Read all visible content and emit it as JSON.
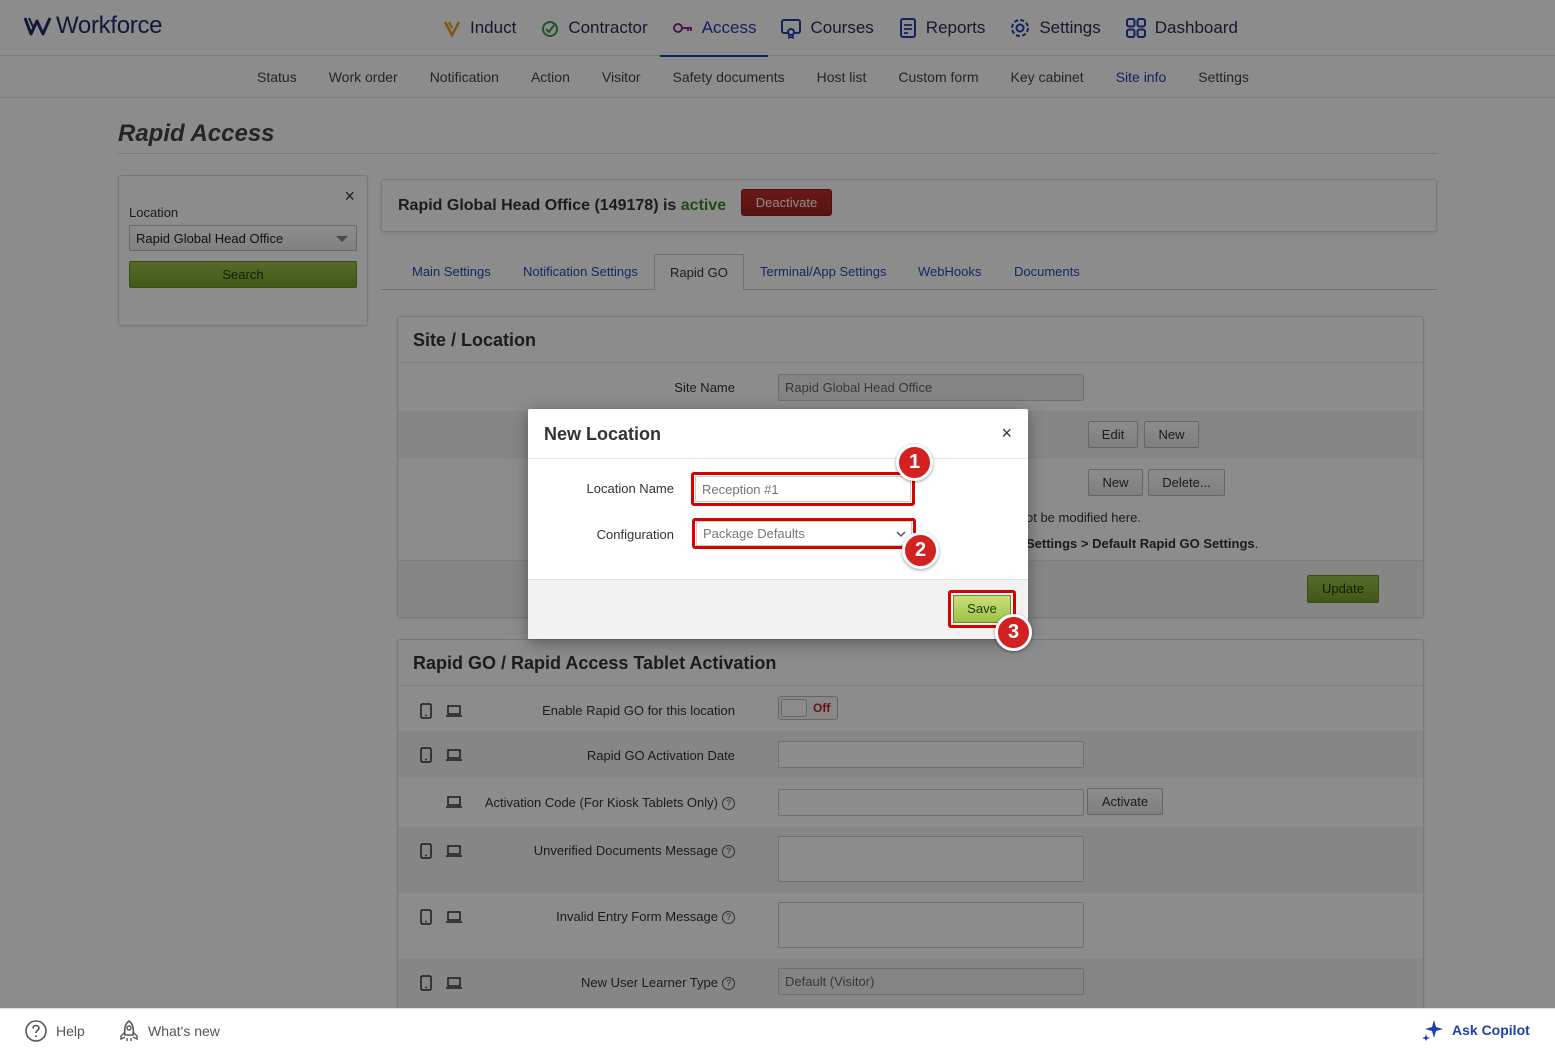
{
  "brand": {
    "name": "Workforce"
  },
  "main_nav": [
    {
      "label": "Induct",
      "icon": "induct-icon",
      "color": "#e0a020",
      "active": false
    },
    {
      "label": "Contractor",
      "icon": "contractor-icon",
      "color": "#3f9a3f",
      "active": false
    },
    {
      "label": "Access",
      "icon": "access-key-icon",
      "color": "#8a2e8a",
      "active": true
    },
    {
      "label": "Courses",
      "icon": "courses-icon",
      "color": "#1f3fae",
      "active": false
    },
    {
      "label": "Reports",
      "icon": "reports-icon",
      "color": "#1f3fae",
      "active": false
    },
    {
      "label": "Settings",
      "icon": "gear-icon",
      "color": "#1f3fae",
      "active": false
    },
    {
      "label": "Dashboard",
      "icon": "dashboard-icon",
      "color": "#1f3fae",
      "active": false
    }
  ],
  "sub_nav": [
    {
      "label": "Status"
    },
    {
      "label": "Work order"
    },
    {
      "label": "Notification"
    },
    {
      "label": "Action"
    },
    {
      "label": "Visitor"
    },
    {
      "label": "Safety documents"
    },
    {
      "label": "Host list"
    },
    {
      "label": "Custom form"
    },
    {
      "label": "Key cabinet"
    },
    {
      "label": "Site info",
      "active": true
    },
    {
      "label": "Settings"
    }
  ],
  "page": {
    "title": "Rapid Access"
  },
  "sidebar": {
    "close": "×",
    "location_label": "Location",
    "location_value": "Rapid Global Head Office",
    "search_label": "Search"
  },
  "status": {
    "prefix": "Rapid Global Head Office (149178) is ",
    "state": "active",
    "deactivate_label": "Deactivate"
  },
  "tabs": [
    {
      "label": "Main Settings"
    },
    {
      "label": "Notification Settings"
    },
    {
      "label": "Rapid GO",
      "selected": true
    },
    {
      "label": "Terminal/App Settings"
    },
    {
      "label": "WebHooks"
    },
    {
      "label": "Documents"
    }
  ],
  "site_panel": {
    "title": "Site / Location",
    "site_name_label": "Site Name",
    "site_name_value": "Rapid Global Head Office",
    "edit_label": "Edit",
    "new_label": "New",
    "new2_label": "New",
    "delete_label": "Delete...",
    "note1": "ot be modified here.",
    "note2": "Settings > Default Rapid GO Settings",
    "note2_end": ".",
    "update_label": "Update"
  },
  "tablet_panel": {
    "title": "Rapid GO / Rapid Access Tablet Activation",
    "enable_label": "Enable Rapid GO for this location",
    "toggle_text": "Off",
    "activation_date_label": "Rapid GO Activation Date",
    "activation_code_label": "Activation Code (For Kiosk Tablets Only)",
    "activate_label": "Activate",
    "unverified_label": "Unverified Documents Message",
    "invalid_label": "Invalid Entry Form Message",
    "learner_label": "New User Learner Type",
    "learner_value": "Default (Visitor)",
    "help_mark": "?"
  },
  "modal": {
    "title": "New Location",
    "close": "×",
    "location_name_label": "Location Name",
    "location_name_placeholder": "Reception #1",
    "configuration_label": "Configuration",
    "configuration_value": "Package Defaults",
    "save_label": "Save",
    "highlight_color": "#d50000"
  },
  "steps": {
    "one": "1",
    "two": "2",
    "three": "3"
  },
  "footer": {
    "help_label": "Help",
    "whats_new_label": "What's new",
    "copilot_label": "Ask Copilot"
  }
}
